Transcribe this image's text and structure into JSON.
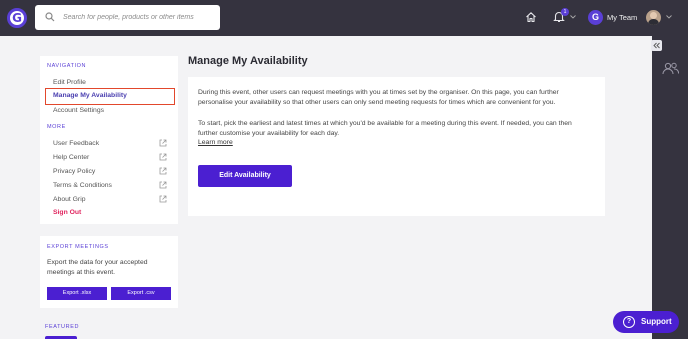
{
  "header": {
    "logo_letter": "G",
    "search_placeholder": "Search for people, products or other items",
    "notification_count": "1",
    "team_logo_letter": "G",
    "team_label": "My Team"
  },
  "sidebar": {
    "navigation_title": "NAVIGATION",
    "items": [
      {
        "label": "Edit Profile"
      },
      {
        "label": "Manage My Availability"
      },
      {
        "label": "Account Settings"
      }
    ],
    "more_title": "MORE",
    "more_items": [
      {
        "label": "User Feedback",
        "icon": "external-link-icon"
      },
      {
        "label": "Help Center",
        "icon": "external-link-icon"
      },
      {
        "label": "Privacy Policy",
        "icon": "external-link-icon"
      },
      {
        "label": "Terms & Conditions",
        "icon": "external-link-icon"
      },
      {
        "label": "About Grip",
        "icon": "external-link-icon"
      }
    ],
    "sign_out": "Sign Out"
  },
  "export": {
    "title": "EXPORT MEETINGS",
    "description": "Export the data for your accepted meetings at this event.",
    "xlsx_label": "Export .xlsx",
    "csv_label": "Export .csv"
  },
  "featured_title": "FEATURED",
  "main": {
    "title": "Manage My Availability",
    "paragraph1": "During this event, other users can request meetings with you at times set by the organiser. On this page, you can further personalise your availability so that other users can only send meeting requests for times which are convenient for you.",
    "paragraph2": "To start, pick the earliest and latest times at which you'd be available for a meeting during this event. If needed, you can then further customise your availability for each day.",
    "learn_more": "Learn more",
    "edit_button": "Edit Availability"
  },
  "support_label": "Support",
  "colors": {
    "accent": "#4b1fd1",
    "topbar": "#35333f",
    "highlight_border": "#e2472c",
    "sign_out": "#e0245e"
  }
}
